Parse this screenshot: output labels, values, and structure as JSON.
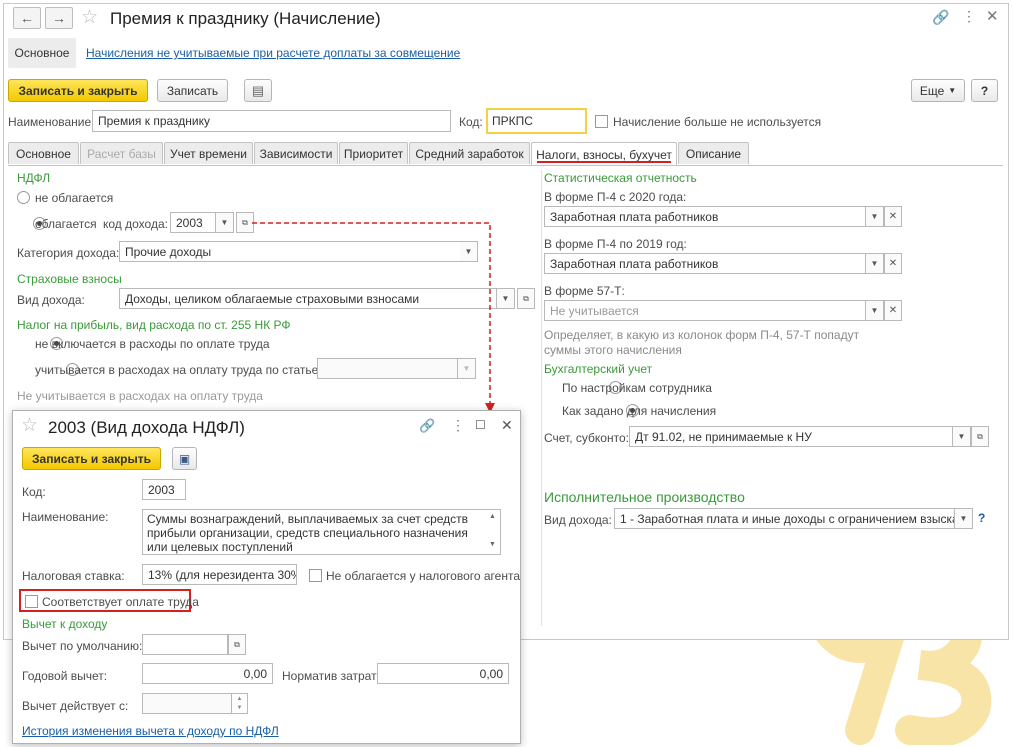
{
  "main": {
    "title": "Премия к празднику (Начисление)",
    "nav_tabs": {
      "main": "Основное",
      "link": "Начисления не учитываемые при расчете доплаты за совмещение"
    },
    "toolbar": {
      "save_close": "Записать и закрыть",
      "save": "Записать",
      "more": "Еще",
      "help": "?"
    },
    "name_label": "Наименование:",
    "name_value": "Премия к празднику",
    "code_label": "Код:",
    "code_value": "ПРКПС",
    "unused_label": "Начисление больше не используется",
    "tabs": [
      "Основное",
      "Расчет базы",
      "Учет времени",
      "Зависимости",
      "Приоритет",
      "Средний заработок",
      "Налоги, взносы, бухучет",
      "Описание"
    ],
    "active_tab": 6
  },
  "ndfl": {
    "header": "НДФЛ",
    "not_taxed": "не облагается",
    "taxed": "облагается",
    "income_code_label": "код дохода:",
    "income_code": "2003",
    "category_label": "Категория дохода:",
    "category_value": "Прочие доходы"
  },
  "insurance": {
    "header": "Страховые взносы",
    "income_type_label": "Вид дохода:",
    "income_type_value": "Доходы, целиком облагаемые страховыми взносами"
  },
  "profit_tax": {
    "header": "Налог на прибыль, вид расхода по ст. 255 НК РФ",
    "opt1": "не включается в расходы по оплате труда",
    "opt2": "учитывается в расходах на оплату труда по статье:",
    "note": "Не учитывается в расходах на оплату труда"
  },
  "stats": {
    "header": "Статистическая отчетность",
    "p4_2020_label": "В форме П-4 с 2020 года:",
    "p4_2020_value": "Заработная плата работников",
    "p4_2019_label": "В форме П-4 по 2019 год:",
    "p4_2019_value": "Заработная плата работников",
    "f57_label": "В форме 57-Т:",
    "f57_placeholder": "Не учитывается",
    "note": "Определяет, в какую из колонок форм П-4, 57-Т попадут суммы этого начисления"
  },
  "accounting": {
    "header": "Бухгалтерский учет",
    "opt1": "По настройкам сотрудника",
    "opt2": "Как задано для начисления",
    "account_label": "Счет, субконто:",
    "account_value": "Дт 91.02, не принимаемые к НУ"
  },
  "enforcement": {
    "header": "Исполнительное производство",
    "income_type_label": "Вид дохода:",
    "income_type_value": "1 - Заработная плата и иные доходы с ограничением взыскания",
    "help": "?"
  },
  "popup": {
    "title": "2003 (Вид дохода НДФЛ)",
    "save_close": "Записать и закрыть",
    "code_label": "Код:",
    "code_value": "2003",
    "name_label": "Наименование:",
    "name_value": "Суммы вознаграждений, выплачиваемых за счет средств прибыли организации, средств специального назначения или целевых поступлений",
    "rate_label": "Налоговая ставка:",
    "rate_value": "13% (для нерезидента 30%)",
    "not_taxed_agent": "Не облагается у налогового агента",
    "labor_pay": "Соответствует оплате труда",
    "deduction_header": "Вычет к доходу",
    "default_deduction_label": "Вычет по умолчанию:",
    "annual_deduction_label": "Годовой вычет:",
    "annual_deduction_value": "0,00",
    "cost_norm_label": "Норматив затрат:",
    "cost_norm_value": "0,00",
    "valid_from_label": "Вычет действует с:",
    "history_link": "История изменения вычета к доходу по НДФЛ"
  },
  "colors": {
    "accent_yellow": "#f3c900",
    "green_header": "#3a9a3a",
    "link": "#1a5fa5",
    "red_highlight": "#d42020"
  }
}
